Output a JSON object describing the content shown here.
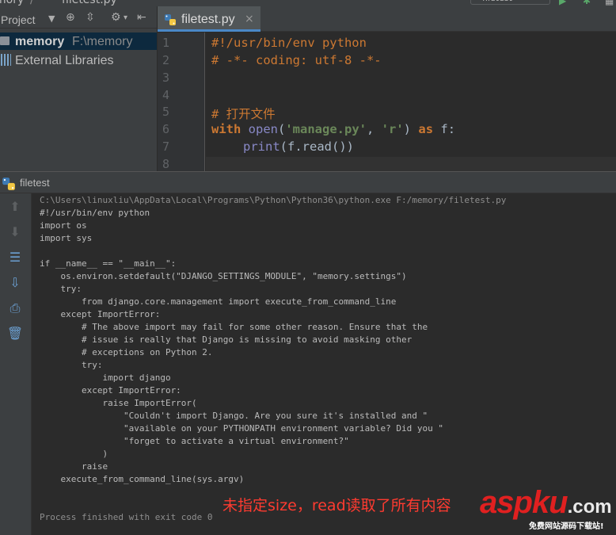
{
  "topbar": {
    "crumb_project": "mory",
    "crumb_file": "filetest.py",
    "run_config": "filetest"
  },
  "project_panel": {
    "title": "Project",
    "tree": [
      {
        "name": "memory",
        "path": "F:\\memory"
      },
      {
        "name": "External Libraries"
      }
    ]
  },
  "editor": {
    "tab": {
      "name": "filetest.py",
      "close": "×"
    },
    "line_numbers": [
      "1",
      "2",
      "3",
      "4",
      "5",
      "6",
      "7",
      "8"
    ],
    "lines": {
      "l1": "#!/usr/bin/env python",
      "l2": "# -*- coding: utf-8 -*-",
      "l5": "# 打开文件",
      "l6_kw": "with",
      "l6_fn": "open",
      "l6_p1": "(",
      "l6_s1": "'manage.py'",
      "l6_p2": ", ",
      "l6_s2": "'r'",
      "l6_p3": ")",
      "l6_as": "as",
      "l6_rest": " f:",
      "l7_fn": "print",
      "l7_rest": "(f.read())"
    }
  },
  "run_panel": {
    "title": "filetest",
    "console": [
      "C:\\Users\\linuxliu\\AppData\\Local\\Programs\\Python\\Python36\\python.exe F:/memory/filetest.py",
      "#!/usr/bin/env python",
      "import os",
      "import sys",
      "",
      "if __name__ == \"__main__\":",
      "    os.environ.setdefault(\"DJANGO_SETTINGS_MODULE\", \"memory.settings\")",
      "    try:",
      "        from django.core.management import execute_from_command_line",
      "    except ImportError:",
      "        # The above import may fail for some other reason. Ensure that the",
      "        # issue is really that Django is missing to avoid masking other",
      "        # exceptions on Python 2.",
      "        try:",
      "            import django",
      "        except ImportError:",
      "            raise ImportError(",
      "                \"Couldn't import Django. Are you sure it's installed and \"",
      "                \"available on your PYTHONPATH environment variable? Did you \"",
      "                \"forget to activate a virtual environment?\"",
      "            )",
      "        raise",
      "    execute_from_command_line(sys.argv)",
      "",
      "",
      "Process finished with exit code 0"
    ]
  },
  "annotation": "未指定size，read读取了所有内容",
  "watermark": {
    "brand": "aspku",
    "tld": ".com",
    "sub": "免费网站源码下载站!"
  },
  "colors": {
    "keyword": "#cc7832",
    "string": "#6a8759",
    "builtin": "#8888c6",
    "annotation": "#ff3b30",
    "brand": "#e02020"
  }
}
